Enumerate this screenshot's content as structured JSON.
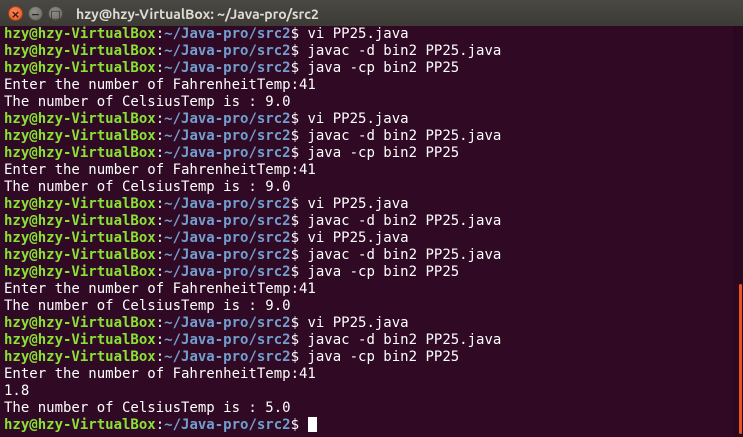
{
  "window": {
    "title": "hzy@hzy-VirtualBox: ~/Java-pro/src2"
  },
  "controls": {
    "close_glyph": "×",
    "minimize_glyph": "−",
    "maximize_glyph": "□"
  },
  "colors": {
    "background": "#300a24",
    "user_host": "#8ae234",
    "path": "#729fcf",
    "text": "#ffffff",
    "scroll_thumb": "#e95420"
  },
  "prompt": {
    "user_host": "hzy@hzy-VirtualBox",
    "sep": ":",
    "path": "~/Java-pro/src2",
    "symbol": "$ "
  },
  "lines": [
    {
      "type": "prompt",
      "cmd": "vi PP25.java"
    },
    {
      "type": "prompt",
      "cmd": "javac -d bin2 PP25.java"
    },
    {
      "type": "prompt",
      "cmd": "java -cp bin2 PP25"
    },
    {
      "type": "output",
      "text": "Enter the number of FahrenheitTemp:41"
    },
    {
      "type": "output",
      "text": "The number of CelsiusTemp is : 9.0"
    },
    {
      "type": "prompt",
      "cmd": "vi PP25.java"
    },
    {
      "type": "prompt",
      "cmd": "javac -d bin2 PP25.java"
    },
    {
      "type": "prompt",
      "cmd": "java -cp bin2 PP25"
    },
    {
      "type": "output",
      "text": "Enter the number of FahrenheitTemp:41"
    },
    {
      "type": "output",
      "text": "The number of CelsiusTemp is : 9.0"
    },
    {
      "type": "prompt",
      "cmd": "vi PP25.java"
    },
    {
      "type": "prompt",
      "cmd": "javac -d bin2 PP25.java"
    },
    {
      "type": "prompt",
      "cmd": "vi PP25.java"
    },
    {
      "type": "prompt",
      "cmd": "javac -d bin2 PP25.java"
    },
    {
      "type": "prompt",
      "cmd": "java -cp bin2 PP25"
    },
    {
      "type": "output",
      "text": "Enter the number of FahrenheitTemp:41"
    },
    {
      "type": "output",
      "text": "The number of CelsiusTemp is : 9.0"
    },
    {
      "type": "prompt",
      "cmd": "vi PP25.java"
    },
    {
      "type": "prompt",
      "cmd": "javac -d bin2 PP25.java"
    },
    {
      "type": "prompt",
      "cmd": "java -cp bin2 PP25"
    },
    {
      "type": "output",
      "text": "Enter the number of FahrenheitTemp:41"
    },
    {
      "type": "output",
      "text": "1.8"
    },
    {
      "type": "output",
      "text": "The number of CelsiusTemp is : 5.0"
    },
    {
      "type": "prompt",
      "cmd": "",
      "cursor": true
    }
  ]
}
